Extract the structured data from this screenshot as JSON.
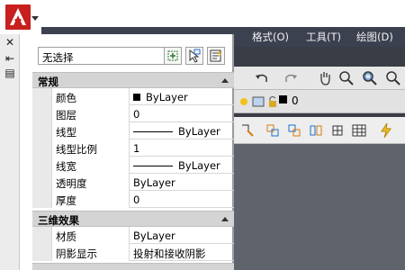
{
  "app": {
    "menubar": [
      "格式(O)",
      "工具(T)",
      "绘图(D)"
    ],
    "toolbar_icons": [
      "undo-icon",
      "redo-icon",
      "pan-icon",
      "zoom-icon",
      "properties-icon"
    ],
    "layer_value": "0"
  },
  "dock": {
    "close_glyph": "✕",
    "pin_glyph": "⇤",
    "menu_glyph": "▤"
  },
  "palette": {
    "selection": "无选择",
    "sections": [
      {
        "title": "常规",
        "rows": [
          {
            "name": "颜色",
            "value": "ByLayer",
            "kind": "color"
          },
          {
            "name": "图层",
            "value": "0"
          },
          {
            "name": "线型",
            "value": "ByLayer",
            "kind": "line"
          },
          {
            "name": "线型比例",
            "value": "1"
          },
          {
            "name": "线宽",
            "value": "ByLayer",
            "kind": "line"
          },
          {
            "name": "透明度",
            "value": "ByLayer"
          },
          {
            "name": "厚度",
            "value": "0"
          }
        ]
      },
      {
        "title": "三维效果",
        "rows": [
          {
            "name": "材质",
            "value": "ByLayer"
          },
          {
            "name": "阴影显示",
            "value": "投射和接收阴影"
          }
        ]
      }
    ]
  },
  "colors": {
    "menubar_bg": "#3c4150",
    "logo_red": "#c8201e",
    "section_header_bg": "#d4d4d4"
  }
}
